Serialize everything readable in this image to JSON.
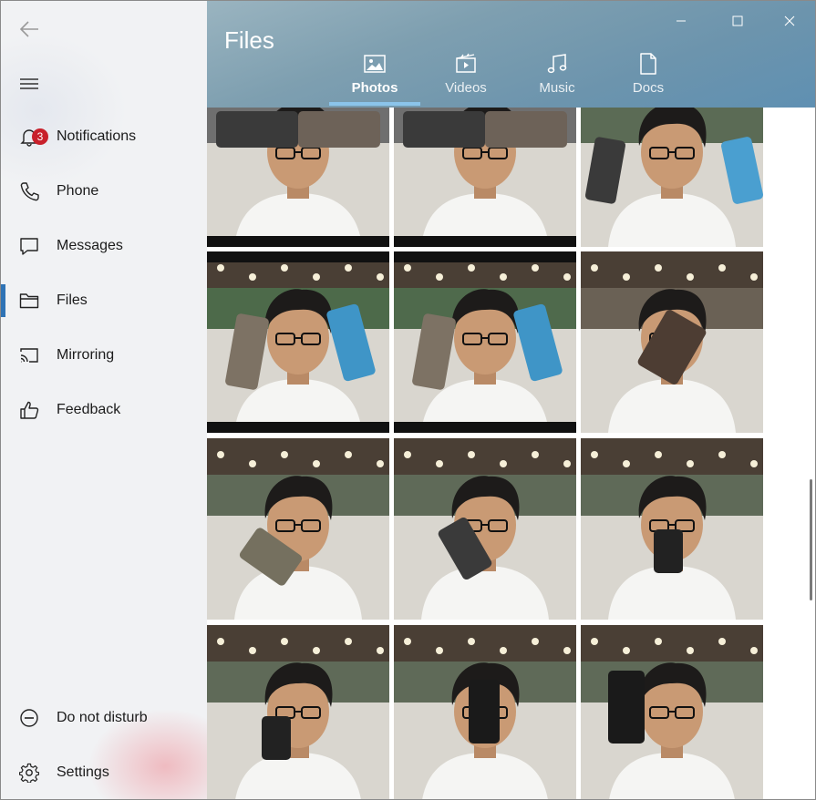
{
  "window": {
    "minimize": "minimize",
    "maximize": "maximize",
    "close": "close"
  },
  "header": {
    "title": "Files",
    "tabs": [
      {
        "label": "Photos",
        "icon": "photo-icon",
        "active": true
      },
      {
        "label": "Videos",
        "icon": "video-icon",
        "active": false
      },
      {
        "label": "Music",
        "icon": "music-icon",
        "active": false
      },
      {
        "label": "Docs",
        "icon": "document-icon",
        "active": false
      }
    ]
  },
  "sidebar": {
    "back_icon": "back-arrow-icon",
    "menu_icon": "hamburger-icon",
    "items": [
      {
        "label": "Notifications",
        "icon": "bell-icon",
        "badge": "3"
      },
      {
        "label": "Phone",
        "icon": "phone-icon"
      },
      {
        "label": "Messages",
        "icon": "message-icon"
      },
      {
        "label": "Files",
        "icon": "folder-icon",
        "active": true
      },
      {
        "label": "Mirroring",
        "icon": "cast-icon"
      },
      {
        "label": "Feedback",
        "icon": "thumbs-up-icon"
      }
    ],
    "bottom": [
      {
        "label": "Do not disturb",
        "icon": "do-not-disturb-icon"
      },
      {
        "label": "Settings",
        "icon": "gear-icon"
      }
    ]
  },
  "photos": [
    {
      "pose": "phone-held-across-face",
      "bg": "#6f6f6f",
      "letterbox": true
    },
    {
      "pose": "phone-held-across-face",
      "bg": "#6f6f6f",
      "letterbox": true
    },
    {
      "pose": "two-phones-at-sides",
      "bg": "#5b6b55",
      "letterbox": false
    },
    {
      "pose": "two-phones-up",
      "bg": "#4d6a4a",
      "letterbox": true
    },
    {
      "pose": "two-phones-up",
      "bg": "#4f6a4c",
      "letterbox": true
    },
    {
      "pose": "phone-covering-face",
      "bg": "#6a6155",
      "letterbox": false
    },
    {
      "pose": "phone-at-left-ear",
      "bg": "#5f6a58",
      "letterbox": false
    },
    {
      "pose": "phone-at-cheek",
      "bg": "#5f6a58",
      "letterbox": false
    },
    {
      "pose": "phone-at-chest",
      "bg": "#5f6a58",
      "letterbox": false
    },
    {
      "pose": "phone-at-chest-small",
      "bg": "#5f6a58",
      "letterbox": false
    },
    {
      "pose": "phone-covering-eye",
      "bg": "#5f6a58",
      "letterbox": false
    },
    {
      "pose": "phone-covering-eye-close",
      "bg": "#5f6a58",
      "letterbox": false
    }
  ]
}
